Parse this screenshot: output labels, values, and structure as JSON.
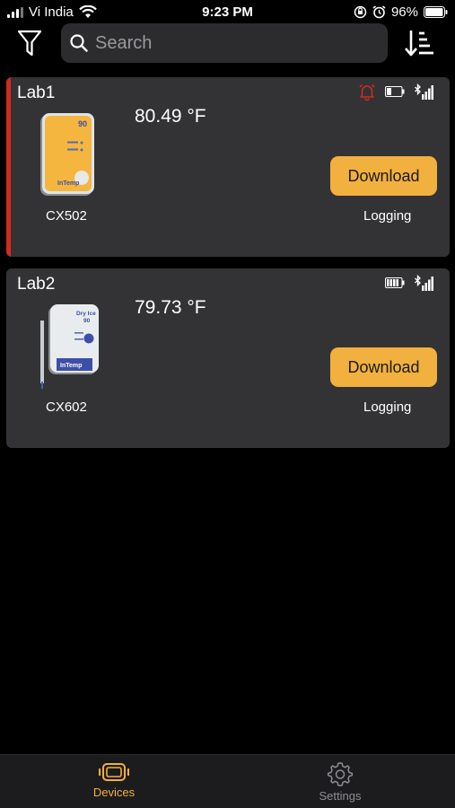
{
  "status_bar": {
    "carrier": "Vi India",
    "time": "9:23 PM",
    "battery": "96%"
  },
  "toolbar": {
    "search_placeholder": "Search",
    "filter_icon": "filter-icon",
    "sort_icon": "sort-icon"
  },
  "devices": [
    {
      "name": "Lab1",
      "temperature": "80.49 °F",
      "model": "CX502",
      "status": "Logging",
      "download_label": "Download",
      "alarm": true,
      "device_label": "90",
      "brand": "InTemp"
    },
    {
      "name": "Lab2",
      "temperature": "79.73 °F",
      "model": "CX602",
      "status": "Logging",
      "download_label": "Download",
      "alarm": false,
      "device_label_top": "Dry Ice",
      "device_label": "90",
      "brand": "InTemp"
    }
  ],
  "tabbar": {
    "tabs": [
      {
        "label": "Devices",
        "active": true
      },
      {
        "label": "Settings",
        "active": false
      }
    ]
  },
  "colors": {
    "accent": "#f2b03e",
    "alarm": "#d42a1f",
    "card_bg": "#333335"
  }
}
